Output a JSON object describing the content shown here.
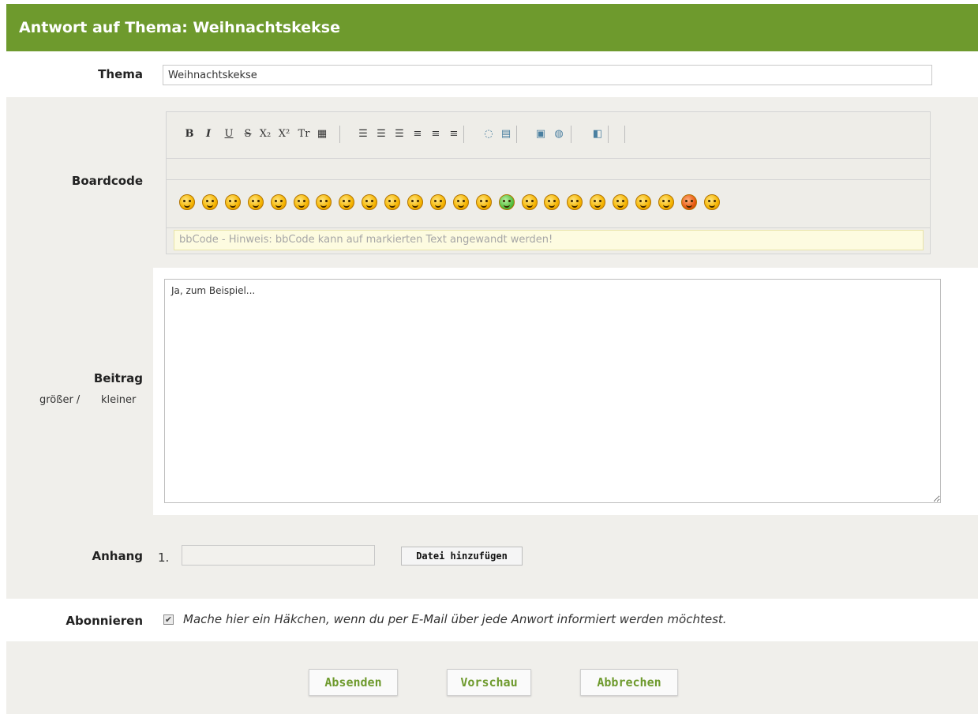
{
  "form": {
    "title": "Antwort auf Thema: Weihnachtskekse",
    "subject": {
      "label": "Thema",
      "value": "Weihnachtskekse"
    },
    "boardcode": {
      "label": "Boardcode",
      "toolbar_buttons": [
        {
          "name": "bold-icon",
          "glyph": "B"
        },
        {
          "name": "italic-icon",
          "glyph": "I"
        },
        {
          "name": "underline-icon",
          "glyph": "U"
        },
        {
          "name": "strikethrough-icon",
          "glyph": "S"
        },
        {
          "name": "subscript-icon",
          "glyph": "X₂"
        },
        {
          "name": "superscript-icon",
          "glyph": "X²"
        },
        {
          "name": "font-size-icon",
          "glyph": "Tr"
        },
        {
          "name": "color-icon",
          "glyph": "▦"
        },
        {
          "name": "list-icon",
          "glyph": "☰"
        },
        {
          "name": "numbered-list-icon",
          "glyph": "☰"
        },
        {
          "name": "list-alt-icon",
          "glyph": "☰"
        },
        {
          "name": "align-left-icon",
          "glyph": "≡"
        },
        {
          "name": "align-center-icon",
          "glyph": "≡"
        },
        {
          "name": "align-right-icon",
          "glyph": "≡"
        },
        {
          "name": "quote-icon",
          "glyph": "◌"
        },
        {
          "name": "code-icon",
          "glyph": "▤"
        },
        {
          "name": "image-icon",
          "glyph": "▣"
        },
        {
          "name": "link-icon",
          "glyph": "◍"
        },
        {
          "name": "media-icon",
          "glyph": "◧"
        }
      ],
      "smiley_count": 24,
      "hint": "bbCode - Hinweis: bbCode kann auf markierten Text angewandt werden!"
    },
    "post": {
      "label": "Beitrag",
      "bigger": "größer /",
      "smaller": "kleiner",
      "value": "Ja, zum Beispiel..."
    },
    "attachment": {
      "label": "Anhang",
      "index": "1.",
      "add_button": "Datei hinzufügen"
    },
    "subscribe": {
      "label": "Abonnieren",
      "checked": true,
      "text": "Mache hier ein Häkchen, wenn du per E-Mail über jede Anwort informiert werden möchtest."
    },
    "buttons": {
      "submit": "Absenden",
      "preview": "Vorschau",
      "cancel": "Abbrechen"
    }
  },
  "colors": {
    "accent": "#6e9a2d",
    "row_grey": "#f0efeb"
  }
}
